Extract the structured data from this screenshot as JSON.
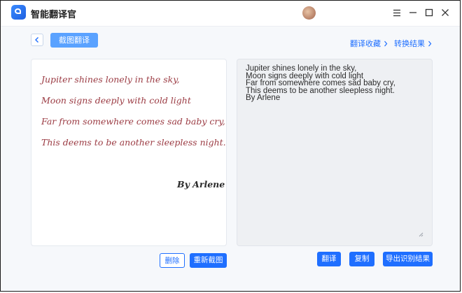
{
  "titlebar": {
    "app_name": "智能翻译官"
  },
  "header": {
    "mode_label": "截图翻译",
    "links": [
      {
        "label": "翻译收藏"
      },
      {
        "label": "转换结果"
      }
    ]
  },
  "source_image": {
    "lines": [
      "Jupiter shines lonely in the sky,",
      "Moon signs deeply with cold light",
      "Far from somewhere comes sad baby cry,",
      "This deems to be another sleepless night."
    ],
    "author": "By Arlene"
  },
  "result": {
    "text": "Jupiter shines lonely in the sky,\nMoon signs deeply with cold light\nFar from somewhere comes sad baby cry,\nThis deems to be another sleepless night.\nBy Arlene"
  },
  "actions": {
    "delete": "删除",
    "recapture": "重新截图",
    "translate": "翻译",
    "copy": "复制",
    "export": "导出识别结果"
  },
  "colors": {
    "accent": "#1f6fff",
    "poem_text": "#9b3b43"
  }
}
